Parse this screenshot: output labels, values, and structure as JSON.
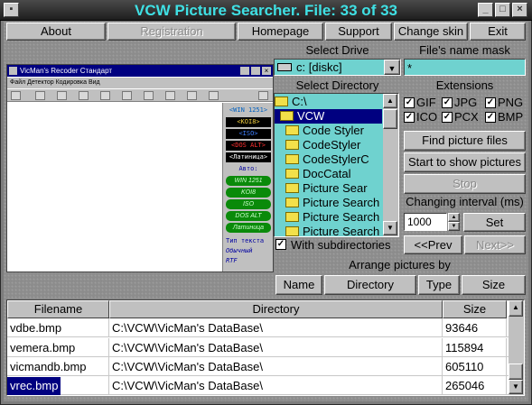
{
  "window": {
    "title": "VCW Picture Searcher. File: 33 of 33",
    "controls": [
      "minimize-icon",
      "maximize-icon",
      "close-icon"
    ]
  },
  "toolbar": {
    "about": "About",
    "registration": "Registration",
    "homepage": "Homepage",
    "support": "Support",
    "change_skin": "Change skin",
    "exit": "Exit"
  },
  "preview": {
    "title": "VicMan's Recoder Стандарт",
    "menu": "Файл  Детектор  Кодировка  Вид",
    "side_buttons": [
      "<WIN 1251>",
      "<KOI8>",
      "<ISO>",
      "<DOS ALT>",
      "<Латиница>"
    ],
    "auto_label": "Авто:",
    "green_buttons": [
      "WIN 1251",
      "KOI8",
      "ISO",
      "DOS ALT",
      "Латиница"
    ],
    "type_label": "Тип текста",
    "radio_1": "Обычный",
    "radio_2": "RTF"
  },
  "drive": {
    "label": "Select Drive",
    "value": "c: [diskc]"
  },
  "mask": {
    "label": "File's name mask",
    "value": "*"
  },
  "directory": {
    "label": "Select Directory",
    "items": [
      "C:\\",
      "VCW",
      "Code Styler",
      "CodeStyler",
      "CodeStylerC",
      "DocCatal",
      "Picture Sear",
      "Picture Search",
      "Picture Search",
      "Picture Search"
    ],
    "selected_index": 1,
    "with_subdirs_label": "With subdirectories",
    "with_subdirs_checked": true
  },
  "extensions": {
    "label": "Extensions",
    "items": [
      {
        "name": "GIF",
        "checked": true
      },
      {
        "name": "JPG",
        "checked": true
      },
      {
        "name": "PNG",
        "checked": true
      },
      {
        "name": "ICO",
        "checked": true
      },
      {
        "name": "PCX",
        "checked": true
      },
      {
        "name": "BMP",
        "checked": true
      }
    ]
  },
  "actions": {
    "find": "Find picture files",
    "start_show": "Start to show pictures",
    "stop": "Stop",
    "interval_label": "Changing interval (ms)",
    "interval_value": "1000",
    "set": "Set",
    "prev": "<<Prev",
    "next": "Next>>"
  },
  "arrange": {
    "label": "Arrange pictures by",
    "name": "Name",
    "directory": "Directory",
    "type": "Type",
    "size": "Size"
  },
  "table": {
    "headers": [
      "Filename",
      "Directory",
      "Size"
    ],
    "rows": [
      {
        "filename": "vdbe.bmp",
        "directory": "C:\\VCW\\VicMan's DataBase\\",
        "size": "93646"
      },
      {
        "filename": "vemera.bmp",
        "directory": "C:\\VCW\\VicMan's DataBase\\",
        "size": "115894"
      },
      {
        "filename": "vicmandb.bmp",
        "directory": "C:\\VCW\\VicMan's DataBase\\",
        "size": "605110"
      },
      {
        "filename": "vrec.bmp",
        "directory": "C:\\VCW\\VicMan's DataBase\\",
        "size": "265046"
      }
    ],
    "selected_index": 3
  },
  "colors": {
    "title_text": "#3fe0e4",
    "list_bg": "#6fd2cf",
    "selection": "#000080"
  }
}
